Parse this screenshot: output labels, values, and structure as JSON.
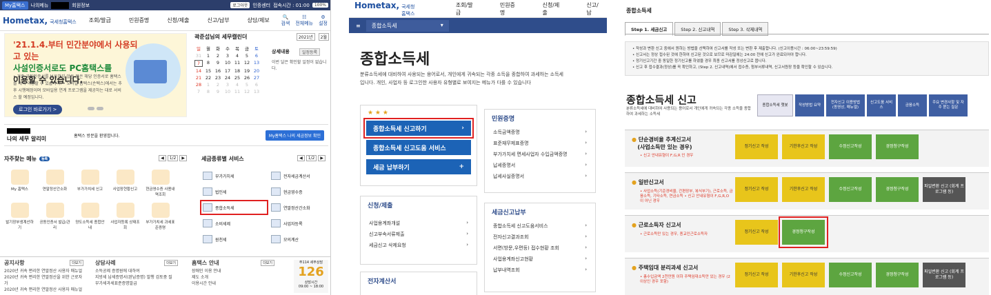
{
  "p1": {
    "top": {
      "my": "My홈택스",
      "fav": "나의메뉴",
      "member": "회원정보",
      "login": "로그아웃",
      "cert": "인증센터",
      "time": "접속시간 : 01:00",
      "zoom": "100%"
    },
    "logo": {
      "main": "Hometax,",
      "sub": "국세청홈택스"
    },
    "menu": [
      "조회/발급",
      "민원증명",
      "신청/제출",
      "신고/납부",
      "상담/제보"
    ],
    "icons": [
      "검색",
      "전체메뉴",
      "설정"
    ],
    "banner": {
      "l1": "'21.1.4.부터 민간분야에서 사용되고 있는",
      "l2": "사설인증서로도 PC홈택스를",
      "l3": "이용할 수 있습니다.",
      "desc": "• 기존 공인인증서를 보유하지 않은 분은 해당 인증서로 홈택스를 계속 이용할 수 있습니다. • 모바일 홈택스(손택스)에서는 추후 시행예정이며 모바일용 연계 프로그램을 제공하는 대로 서비스 할 예정입니다.",
      "cta": "로그인 바로가기 >"
    },
    "cal": {
      "title": "곽준섭님의 세무캘린더",
      "year": "2021년",
      "month": "2월",
      "days": [
        "일",
        "월",
        "화",
        "수",
        "목",
        "금",
        "토"
      ],
      "rows": [
        [
          "31",
          "1",
          "2",
          "3",
          "4",
          "5",
          "6"
        ],
        [
          "7",
          "8",
          "9",
          "10",
          "11",
          "12",
          "13"
        ],
        [
          "14",
          "15",
          "16",
          "17",
          "18",
          "19",
          "20"
        ],
        [
          "21",
          "22",
          "23",
          "24",
          "25",
          "26",
          "27"
        ],
        [
          "28",
          "1",
          "2",
          "3",
          "4",
          "5",
          "6"
        ],
        [
          "7",
          "8",
          "9",
          "10",
          "11",
          "12",
          "13"
        ]
      ],
      "detail": "상세내용",
      "btn": "일정등록",
      "note": "이번 달은 확인할 일정이 없습니다."
    },
    "my": {
      "label": "나의 세무 알리미",
      "greet": "홈택스 방문을 환영합니다.",
      "btn": "My홈택스 나의 세금정보 확인"
    },
    "favs": {
      "title": "자주찾는 메뉴",
      "tag": "등록",
      "page": "1/2",
      "items": [
        "My 홈택스",
        "연말정산간소화",
        "부가가치세 신고",
        "사업장현황신고",
        "현금영수증 사용내역조회",
        "발기장부생계산하기",
        "공동인증서 발급/관리",
        "양도소득세 종합안내",
        "사업자등록 상태조회",
        "부가가치세 과세표준증명"
      ]
    },
    "tax": {
      "title": "세금종류별 서비스",
      "page": "1/2",
      "items": [
        "부가가치세",
        "전자세금계산서",
        "법인세",
        "현금영수증",
        "종합소득세",
        "연말정산간소화",
        "소비세제",
        "사업자등록",
        "원천세",
        "모의계산"
      ]
    },
    "bottom": {
      "notice": {
        "h": "공지사항",
        "more": "더보기",
        "items": [
          "2020년 귀속 편리한 연말정산 사용자 매뉴얼",
          "2020년 귀속 편리한 연말정산을 위한 근로자 가",
          "2020년 귀속 편리한 연말정산 사용자 매뉴얼"
        ]
      },
      "cons": {
        "h": "상담사례",
        "more": "더보기",
        "items": [
          "소득공제 증명원에 대하여",
          "지방세 납세증명서(완납증명) 발행 검토중 질",
          "부가세과세표준증명발급"
        ]
      },
      "guide": {
        "h": "홈택스 안내",
        "more": "더보기",
        "items": [
          "장애인 이용 안내",
          "제도 소개",
          "이용시간 안내"
        ]
      },
      "clock": {
        "top": "주114 세무상담",
        "num": "126",
        "l": "상담시간",
        "t": "09:00 ~ 18:00"
      }
    }
  },
  "p2": {
    "logo": {
      "main": "Hometax,",
      "sub": "국세청홈택스"
    },
    "menu": [
      "조회/발급",
      "민원증명",
      "신청/제출",
      "신고/납"
    ],
    "bar": "종합소득세",
    "title": "종합소득세",
    "desc": "분류소득세에 대비하여 사용되는 용어로서, 개인에게 귀속되는 각종 소득을 종합하여 과세하는 소득세입니다. 개인, 사업자 등 로그인한 사용자 유형별로 보여지는 메뉴가 다를 수 있습니다",
    "stars": "★ ★ ★",
    "btns": [
      "종합소득세 신고하기",
      "종합소득세 신고도움 서비스",
      "세금 납부하기"
    ],
    "cert": {
      "title": "민원증명",
      "items": [
        "소득금액증명",
        "표준재무제표증명",
        "부가가치세 면세사업자 수입금액증명",
        "납세증명서",
        "납세사실증명서"
      ]
    },
    "apply": {
      "title": "신청/제출",
      "items": [
        "사업용계좌개설",
        "신고부속서류제출",
        "세금신고 삭제요청"
      ]
    },
    "pay": {
      "title": "세금신고납부",
      "items": [
        "종합소득세 신고도움서비스",
        "전자신고결과조회",
        "서면(방문,우편등) 접수현황 조회",
        "사업용계좌신고현황",
        "납부내역조회"
      ]
    },
    "einv": {
      "title": "전자계산서"
    }
  },
  "p3": {
    "title": "종합소득세",
    "tabs": [
      "Step 1. 세금신고",
      "Step 2. 신고내역",
      "Step 3. 삭제내역"
    ],
    "notice": [
      "• 작성과 변환 신고 중에서 원하는 방법을 선택하여 신고서를 작성 또는 변환 후 제출합니다. (신고이용시간 : 06:00~23:59:59)",
      "• 신고서는 정상 접수된 것에 한하여 신고된 것으로 보므로 마감일에는 24:00 전에 신고가 완료되어야 합니다.",
      "• 정기신고기간 중 동일한 정기신고를 하였을 경우 최종 신고서를 정상신고로 봅니다.",
      "• 신고 후 접수결과(정상)를 꼭 확인하고, (Step 2. 신고내역)에서 접수증, 첨부서류내역, 신고서원장 등을 확인할 수 있습니다."
    ],
    "h": "종합소득세 신고",
    "hd": "분류소득세에 대비하여 사용되는 용어로서 개인에게 귀속되는 각종 소득을 종합하여 과세하는 소득세",
    "qbtns": [
      "종합소득세 챗봇",
      "작성방법 요약",
      "전자신고 이용방법 (동영상, 매뉴얼)",
      "신고도움 서비스",
      "금융소득",
      "주요 변경사항 및 자주 묻는 질문"
    ],
    "rows": [
      {
        "nm": "단순경비율 추계신고서",
        "nm2": "(사업소득만 있는 경우)",
        "sub": "• 신고 안내유형이 F,G,R 인 경우",
        "b": [
          "정기신고 작성",
          "기한후신고 작성",
          "수정신고작성",
          "경정청구작성"
        ]
      },
      {
        "nm": "일반신고서",
        "nm2": "",
        "sub": "• 사업소득(기준경비율, 간편장부, 복식부기), 근로소득, 금융소득, 기타소득, 연금소득 • 신고 안내유형이 F,G,R,O 이 아닌 경우",
        "b": [
          "정기신고 작성",
          "기한후신고 작성",
          "수정신고작성",
          "경정청구작성",
          "파일변환 신고 (회계 프로그램 등)"
        ]
      },
      {
        "nm": "근로소득자 신고서",
        "nm2": "",
        "sub": "• 근로소득만 있는 경우, 종교인근로소득자",
        "b": [
          "정기신고 작성",
          "경정청구작성"
        ]
      },
      {
        "nm": "주택임대 분리과세 신고서",
        "nm2": "",
        "sub": "• 총수입금액 2천만원 이하 주택임대소득만 있는 경우 (2 이상인 경우 포함)",
        "b": [
          "정기신고 작성",
          "기한후신고 작성",
          "수정신고작성",
          "경정청구작성",
          "파일변환 신고 (회계 프로그램 등)"
        ]
      }
    ]
  }
}
